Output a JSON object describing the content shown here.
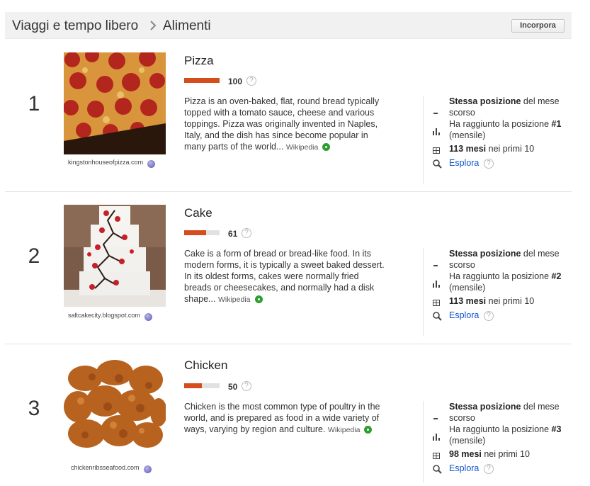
{
  "header": {
    "breadcrumb": [
      "Viaggi e tempo libero",
      "Alimenti"
    ],
    "embed_label": "Incorpora"
  },
  "items": [
    {
      "rank": "1",
      "title": "Pizza",
      "score": "100",
      "score_value": 100,
      "description": "Pizza is an oven-baked, flat, round bread typically topped with a tomato sauce, cheese and various toppings. Pizza was originally invented in Naples, Italy, and the dish has since become popular in many parts of the world...",
      "wiki_label": "Wikipedia",
      "image_source": "kingstonhouseofpizza.com",
      "stat_position_bold": "Stessa posizione",
      "stat_position_rest": " del mese scorso",
      "stat_peak_text": "Ha raggiunto la posizione ",
      "stat_peak_rank": "#1",
      "stat_peak_suffix": " (mensile)",
      "stat_months_bold": "113 mesi",
      "stat_months_rest": " nei primi 10",
      "explore_label": "Esplora"
    },
    {
      "rank": "2",
      "title": "Cake",
      "score": "61",
      "score_value": 61,
      "description": "Cake is a form of bread or bread-like food. In its modern forms, it is typically a sweet baked dessert. In its oldest forms, cakes were normally fried breads or cheesecakes, and normally had a disk shape...",
      "wiki_label": "Wikipedia",
      "image_source": "saltcakecity.blogspot.com",
      "stat_position_bold": "Stessa posizione",
      "stat_position_rest": " del mese scorso",
      "stat_peak_text": "Ha raggiunto la posizione ",
      "stat_peak_rank": "#2",
      "stat_peak_suffix": " (mensile)",
      "stat_months_bold": "113 mesi",
      "stat_months_rest": " nei primi 10",
      "explore_label": "Esplora"
    },
    {
      "rank": "3",
      "title": "Chicken",
      "score": "50",
      "score_value": 50,
      "description": "Chicken is the most common type of poultry in the world, and is prepared as food in a wide variety of ways, varying by region and culture.",
      "wiki_label": "Wikipedia",
      "image_source": "chickenribsseafood.com",
      "stat_position_bold": "Stessa posizione",
      "stat_position_rest": " del mese scorso",
      "stat_peak_text": "Ha raggiunto la posizione ",
      "stat_peak_rank": "#3",
      "stat_peak_suffix": " (mensile)",
      "stat_months_bold": "98 mesi",
      "stat_months_rest": " nei primi 10",
      "explore_label": "Esplora"
    }
  ],
  "icons": {
    "breadcrumb_separator": "chevron-right-icon",
    "help": "help-icon",
    "source_info": "info-icon",
    "wikipedia": "wikipedia-link-icon",
    "position": "dash-icon",
    "peak": "bar-chart-icon",
    "months": "calendar-grid-icon",
    "explore": "search-icon"
  },
  "colors": {
    "bar_fill": "#d54c1d",
    "bar_track": "#e1e1e1",
    "link": "#1155cc",
    "header_bg": "#f1f1f1"
  },
  "help_glyph": "?"
}
